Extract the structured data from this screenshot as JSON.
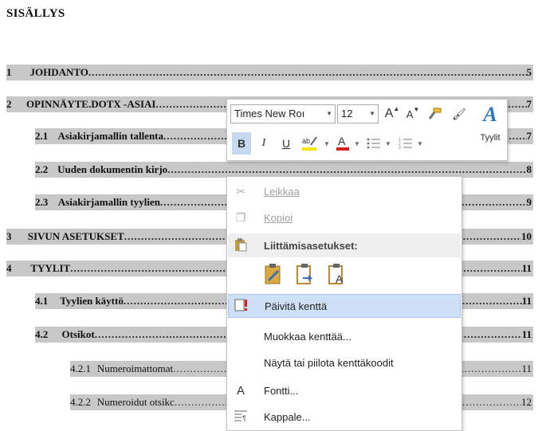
{
  "toc": {
    "title": "SISÄLLYS",
    "entries": [
      {
        "num": "1",
        "text": "JOHDANTO",
        "page": "5"
      },
      {
        "num": "2",
        "text": "OPINNÄYTE.DOTX -ASIAI",
        "page": "7"
      },
      {
        "num": "2.1",
        "text": "Asiakirjamallin tallenta",
        "page": "7"
      },
      {
        "num": "2.2",
        "text": "Uuden dokumentin kirjo",
        "page": "8"
      },
      {
        "num": "2.3",
        "text": "Asiakirjamallin tyylien",
        "page": "9"
      },
      {
        "num": "3",
        "text": "SIVUN ASETUKSET",
        "page": "10"
      },
      {
        "num": "4",
        "text": "TYYLIT",
        "page": "11"
      },
      {
        "num": "4.1",
        "text": "Tyylien käyttö",
        "page": "11"
      },
      {
        "num": "4.2",
        "text": "Otsikot",
        "page": "11"
      },
      {
        "num": "4.2.1",
        "text": "Numeroimattomat",
        "page": "11"
      },
      {
        "num": "4.2.2",
        "text": "Numeroidut otsikc",
        "page": "12"
      }
    ]
  },
  "mini_toolbar": {
    "font_name": "Times New Roı",
    "font_size": "12",
    "grow_font": "A",
    "shrink_font": "A",
    "bold": "B",
    "italic": "I",
    "underline": "U",
    "styles_label": "Tyylit",
    "highlight_color": "#f5e600",
    "font_color": "#d4201f"
  },
  "context_menu": {
    "cut": "Leikkaa",
    "copy": "Kopioi",
    "paste_options_header": "Liittämisasetukset:",
    "update_field": "Päivitä kenttä",
    "edit_field": "Muokkaa kenttää...",
    "toggle_field_codes": "Näytä tai piilota kenttäkoodit",
    "font": "Fontti...",
    "paragraph": "Kappale..."
  },
  "colors": {
    "toc_highlight": "#c8c8c8",
    "menu_highlight": "#cde0f5",
    "accent": "#2a73c7"
  }
}
